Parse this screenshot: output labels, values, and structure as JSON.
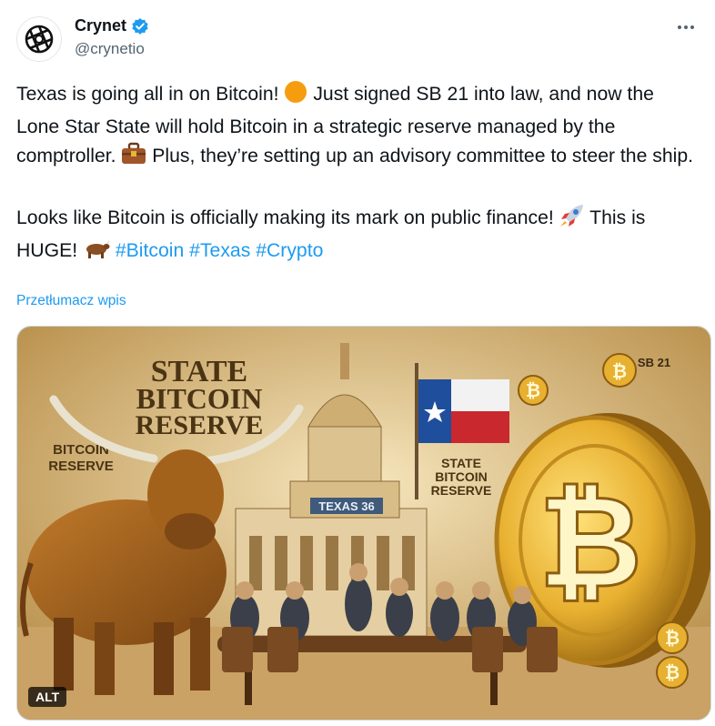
{
  "author": {
    "display_name": "Crynet",
    "handle": "@crynetio",
    "verified": true,
    "avatar_icon": "crynet-logo-icon"
  },
  "tweet": {
    "paragraph1": [
      "Texas is going all in on Bitcoin! ",
      " Just signed SB 21 into law, and now the Lone Star State will hold Bitcoin in a strategic reserve managed by the comptroller. ",
      " Plus, they’re setting up an advisory committee to steer the ship."
    ],
    "paragraph2": [
      "Looks like Bitcoin is officially making its mark on public finance! ",
      " This is HUGE! ",
      " "
    ],
    "hashtags": [
      "#Bitcoin",
      "#Texas",
      "#Crypto"
    ],
    "emojis": [
      "orange-circle-icon",
      "briefcase-icon",
      "rocket-icon",
      "ox-icon"
    ]
  },
  "translate_link": "Przetłumacz wpis",
  "media": {
    "alt_label": "ALT",
    "image_text": {
      "headline": [
        "STATE",
        "BITCOIN",
        "RESERVE"
      ],
      "left_sign": [
        "BITCOIN",
        "RESERVE"
      ],
      "center_sign": [
        "STATE",
        "BITCOIN",
        "RESERVE"
      ],
      "building_sign": "TEXAS 36",
      "top_right": "SB 21"
    },
    "colors": {
      "sky": "#e8cf95",
      "gold": "#e8b630",
      "bull": "#a5641c",
      "link": "#1d9bf0"
    }
  }
}
